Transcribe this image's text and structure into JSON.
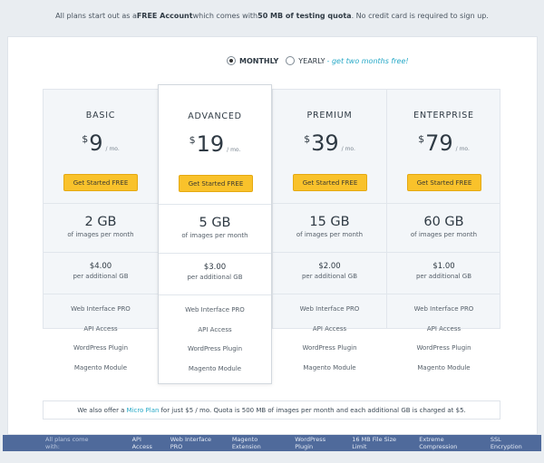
{
  "topbar": {
    "pre": "All plans start out as a ",
    "free": "FREE Account",
    "mid": " which comes with ",
    "quota": "50 MB of testing quota",
    "post": ". No credit card is required to sign up."
  },
  "toggle": {
    "monthly": "MONTHLY",
    "yearly": "YEARLY",
    "promo": "- get two months free!"
  },
  "plans": [
    {
      "name": "BASIC",
      "currency": "$",
      "price": "9",
      "per": "/ mo.",
      "button": "Get Started FREE",
      "quota": "2 GB",
      "quota_note": "of images per month",
      "extra": "$4.00",
      "extra_note": "per additional GB",
      "features": [
        "Web Interface PRO",
        "API Access",
        "WordPress Plugin",
        "Magento Module"
      ]
    },
    {
      "name": "ADVANCED",
      "currency": "$",
      "price": "19",
      "per": "/ mo.",
      "button": "Get Started FREE",
      "quota": "5 GB",
      "quota_note": "of images per month",
      "extra": "$3.00",
      "extra_note": "per additional GB",
      "features": [
        "Web Interface PRO",
        "API Access",
        "WordPress Plugin",
        "Magento Module"
      ]
    },
    {
      "name": "PREMIUM",
      "currency": "$",
      "price": "39",
      "per": "/ mo.",
      "button": "Get Started FREE",
      "quota": "15 GB",
      "quota_note": "of images per month",
      "extra": "$2.00",
      "extra_note": "per additional GB",
      "features": [
        "Web Interface PRO",
        "API Access",
        "WordPress Plugin",
        "Magento Module"
      ]
    },
    {
      "name": "ENTERPRISE",
      "currency": "$",
      "price": "79",
      "per": "/ mo.",
      "button": "Get Started FREE",
      "quota": "60 GB",
      "quota_note": "of images per month",
      "extra": "$1.00",
      "extra_note": "per additional GB",
      "features": [
        "Web Interface PRO",
        "API Access",
        "WordPress Plugin",
        "Magento Module"
      ]
    }
  ],
  "micro": {
    "pre": "We also offer a",
    "link": "Micro Plan",
    "post": "for just $5 / mo. Quota is 500 MB of images per month and each additional GB is charged at $5."
  },
  "footer": {
    "lead": "All plans come with:",
    "features": [
      "API Access",
      "Web Interface PRO",
      "Magento Extension",
      "WordPress Plugin",
      "16 MB File Size Limit",
      "Extreme Compression",
      "SSL Encryption"
    ]
  },
  "colors": {
    "button": "#f9c22b",
    "accent": "#27a9c7",
    "footer": "#4f6a9b"
  }
}
